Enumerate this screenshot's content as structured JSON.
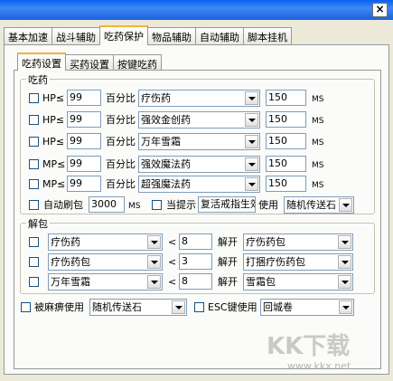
{
  "window": {
    "close_glyph": "×"
  },
  "tabs": [
    "基本加速",
    "战斗辅助",
    "吃药保护",
    "物品辅助",
    "自动辅助",
    "脚本挂机"
  ],
  "subtabs": [
    "吃药设置",
    "买药设置",
    "按键吃药"
  ],
  "potion_group": {
    "label": "吃药",
    "percent_label": "百分比",
    "unit": "MS",
    "rows": [
      {
        "stat": "HP≤",
        "value": "99",
        "item": "疗伤药",
        "delay": "150"
      },
      {
        "stat": "HP≤",
        "value": "99",
        "item": "强效金创药",
        "delay": "150"
      },
      {
        "stat": "HP≤",
        "value": "99",
        "item": "万年雪霜",
        "delay": "150"
      },
      {
        "stat": "MP≤",
        "value": "99",
        "item": "强效魔法药",
        "delay": "150"
      },
      {
        "stat": "MP≤",
        "value": "99",
        "item": "超强魔法药",
        "delay": "150"
      }
    ],
    "auto_refresh_label": "自动刷包",
    "auto_refresh_value": "3000",
    "auto_refresh_unit": "MS",
    "when_prompt_label": "当提示",
    "when_prompt_value": "复活戒指生效",
    "use_label": "使用",
    "use_item": "随机传送石"
  },
  "unpack_group": {
    "label": "解包",
    "less_than": "<",
    "unpack_label": "解开",
    "rows": [
      {
        "item": "疗伤药",
        "count": "8",
        "package": "疗伤药包"
      },
      {
        "item": "疗伤药包",
        "count": "3",
        "package": "打捆疗伤药包"
      },
      {
        "item": "万年雪霜",
        "count": "8",
        "package": "雪霜包"
      }
    ]
  },
  "bottom": {
    "paralyzed_label": "被麻痹使用",
    "paralyzed_item": "随机传送石",
    "esc_label": "ESC键使用",
    "esc_item": "回城卷"
  },
  "watermark": {
    "text": "KK下载",
    "url": "www.kkx.net"
  }
}
